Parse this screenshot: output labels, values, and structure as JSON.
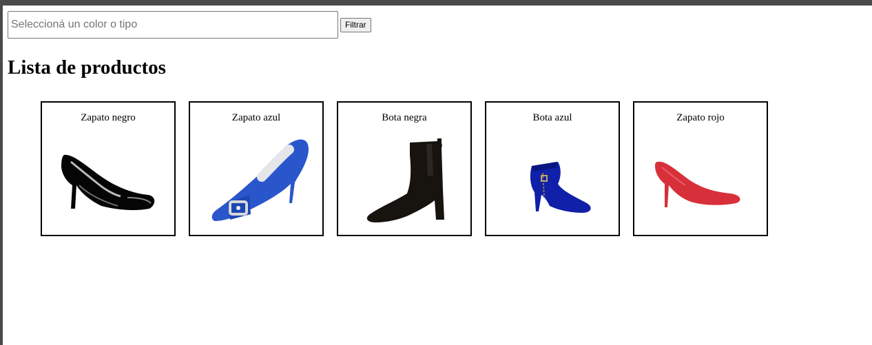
{
  "search": {
    "placeholder": "Seleccioná un color o tipo",
    "value": "",
    "button_label": "Filtrar"
  },
  "page_title": "Lista de productos",
  "products": [
    {
      "name": "Zapato negro",
      "image": "black-pump-image",
      "color": "#0a0a0a"
    },
    {
      "name": "Zapato azul",
      "image": "blue-satin-pump-image",
      "color": "#2b55c7"
    },
    {
      "name": "Bota negra",
      "image": "black-ankle-boot-image",
      "color": "#1a1714"
    },
    {
      "name": "Bota azul",
      "image": "blue-ankle-boot-image",
      "color": "#1323a8"
    },
    {
      "name": "Zapato rojo",
      "image": "red-pump-image",
      "color": "#d9303a"
    }
  ]
}
